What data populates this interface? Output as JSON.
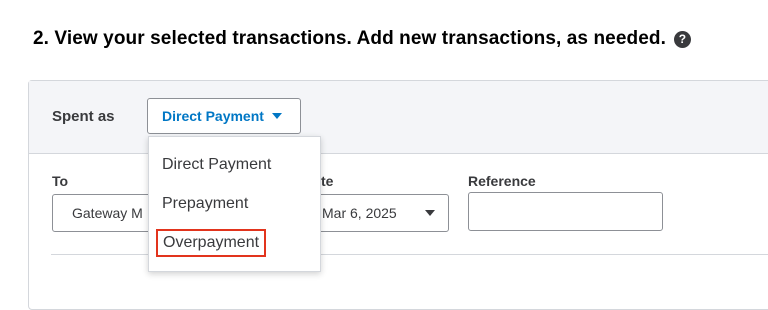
{
  "section": {
    "title": "2. View your selected transactions. Add new transactions, as needed.",
    "help_icon": "question-circle-icon"
  },
  "header": {
    "spent_as_label": "Spent as",
    "spent_as_value": "Direct Payment"
  },
  "fields": {
    "to_label": "To",
    "to_value": "Gateway M",
    "date_label": "te",
    "date_value": "Mar 6, 2025",
    "reference_label": "Reference",
    "reference_value": ""
  },
  "menu": {
    "items": [
      "Direct Payment",
      "Prepayment",
      "Overpayment"
    ],
    "highlighted": "Overpayment"
  },
  "colors": {
    "accent": "#0077c5",
    "highlight_border": "#e2341d",
    "panel_header_bg": "#f4f5f8"
  }
}
